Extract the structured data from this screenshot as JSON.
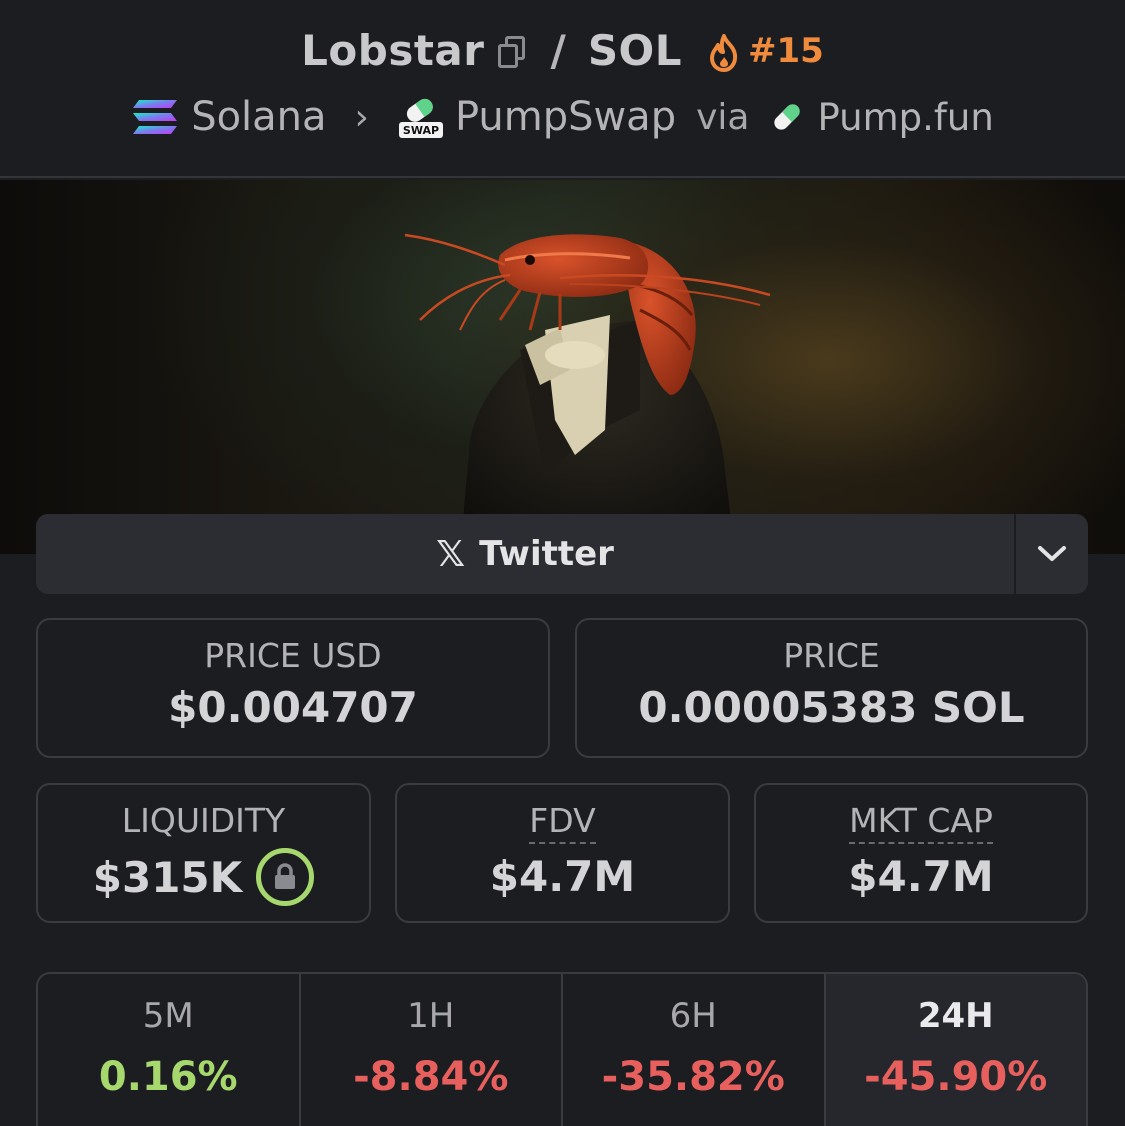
{
  "header": {
    "token_name": "Lobstar",
    "separator": "/",
    "quote": "SOL",
    "rank": "#15",
    "chain": "Solana",
    "dex": "PumpSwap",
    "via_label": "via",
    "launchpad": "Pump.fun",
    "swap_badge": "SWAP"
  },
  "social": {
    "twitter_label": "Twitter"
  },
  "stats": {
    "price_usd": {
      "label": "PRICE USD",
      "value": "$0.004707"
    },
    "price": {
      "label": "PRICE",
      "value": "0.00005383 SOL"
    },
    "liquidity": {
      "label": "LIQUIDITY",
      "value": "$315K"
    },
    "fdv": {
      "label": "FDV",
      "value": "$4.7M"
    },
    "mkt_cap": {
      "label": "MKT CAP",
      "value": "$4.7M"
    }
  },
  "timeframes": [
    {
      "label": "5M",
      "change": "0.16%",
      "color": "#a7d86e"
    },
    {
      "label": "1H",
      "change": "-8.84%",
      "color": "#e8605e"
    },
    {
      "label": "6H",
      "change": "-35.82%",
      "color": "#e8605e"
    },
    {
      "label": "24H",
      "change": "-45.90%",
      "color": "#e8605e"
    }
  ],
  "colors": {
    "background": "#1c1d21",
    "rank_orange": "#f08a3c",
    "positive": "#a7d86e",
    "negative": "#e8605e",
    "lock_green": "#a7d86e"
  },
  "icons": [
    "copy-icon",
    "fire-icon",
    "solana-logo-icon",
    "pumpswap-logo-icon",
    "pumpfun-pill-icon",
    "x-logo-icon",
    "chevron-down-icon",
    "lock-icon"
  ]
}
